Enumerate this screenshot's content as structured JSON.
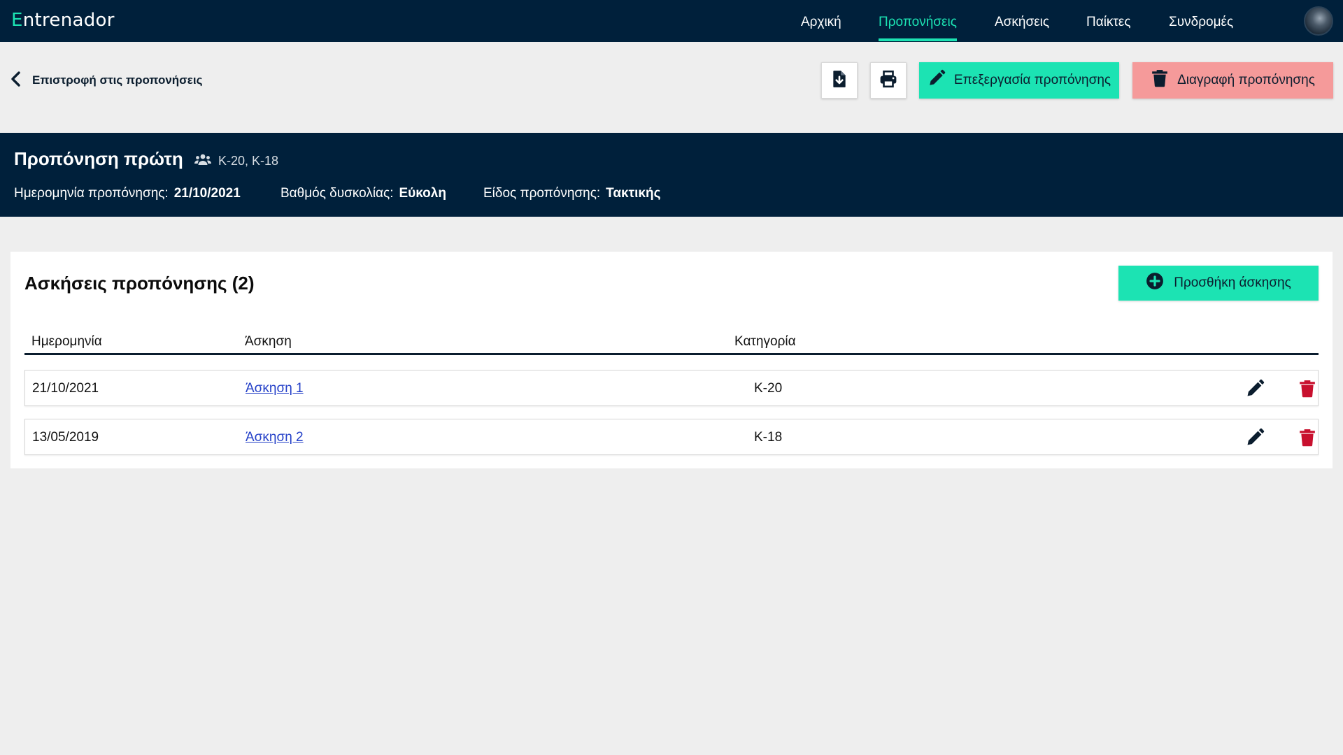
{
  "brand": {
    "first_letter": "E",
    "rest": "ntrenador",
    "accent_color": "#1ce3b3"
  },
  "nav": {
    "items": [
      {
        "label": "Αρχική",
        "active": false
      },
      {
        "label": "Προπονήσεις",
        "active": true
      },
      {
        "label": "Ασκήσεις",
        "active": false
      },
      {
        "label": "Παίκτες",
        "active": false
      },
      {
        "label": "Συνδρομές",
        "active": false
      }
    ]
  },
  "toolbar": {
    "back_label": "Επιστροφή στις προπονήσεις",
    "download_icon": "file-download-icon",
    "print_icon": "print-icon",
    "edit_label": "Επεξεργασία προπόνησης",
    "delete_label": "Διαγραφή προπόνησης"
  },
  "session": {
    "title": "Προπόνηση πρώτη",
    "groups": "Κ-20, Κ-18",
    "date_label": "Ημερομηνία προπόνησης:",
    "date_value": "21/10/2021",
    "difficulty_label": "Βαθμός δυσκολίας:",
    "difficulty_value": "Εύκολη",
    "type_label": "Είδος προπόνησης:",
    "type_value": "Τακτικής"
  },
  "exercises": {
    "title": "Ασκήσεις προπόνησης (2)",
    "add_label": "Προσθήκη άσκησης",
    "columns": [
      "Ημερομηνία",
      "Άσκηση",
      "Κατηγορία"
    ],
    "rows": [
      {
        "date": "21/10/2021",
        "name": "Άσκηση 1",
        "category": "Κ-20"
      },
      {
        "date": "13/05/2019",
        "name": "Άσκηση 2",
        "category": "Κ-18"
      }
    ]
  },
  "colors": {
    "navy": "#00203b",
    "accent": "#1ce3b3",
    "danger_button": "#f59a9a",
    "danger_icon": "#c8102e",
    "link": "#2440c8"
  }
}
